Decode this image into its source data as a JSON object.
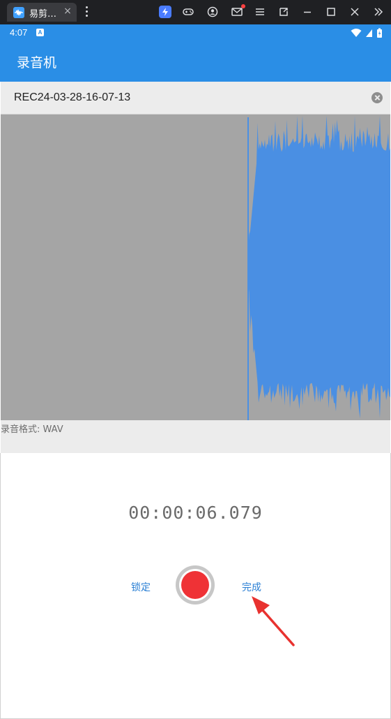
{
  "emulator": {
    "tab_title": "易剪…",
    "tab_close": "×",
    "icons": [
      "app-icon",
      "boost-icon",
      "gamepad-icon",
      "account-icon",
      "mail-icon",
      "menu-icon",
      "screen-rotate-icon",
      "minimize-icon",
      "maximize-icon",
      "close-icon",
      "expand-icon"
    ]
  },
  "status_bar": {
    "time": "4:07",
    "notification_badge": "A"
  },
  "app_bar": {
    "title": "录音机"
  },
  "recording": {
    "file_name": "REC24-03-28-16-07-13",
    "format_label": "录音格式: WAV",
    "elapsed": "00:00:06.079"
  },
  "controls": {
    "lock_label": "锁定",
    "done_label": "完成"
  },
  "colors": {
    "accent": "#2a8ee6",
    "record": "#ef3236",
    "waveform": "#4a8fe3",
    "waveform_bg": "#a5a5a5",
    "annotation": "#e8322f"
  }
}
